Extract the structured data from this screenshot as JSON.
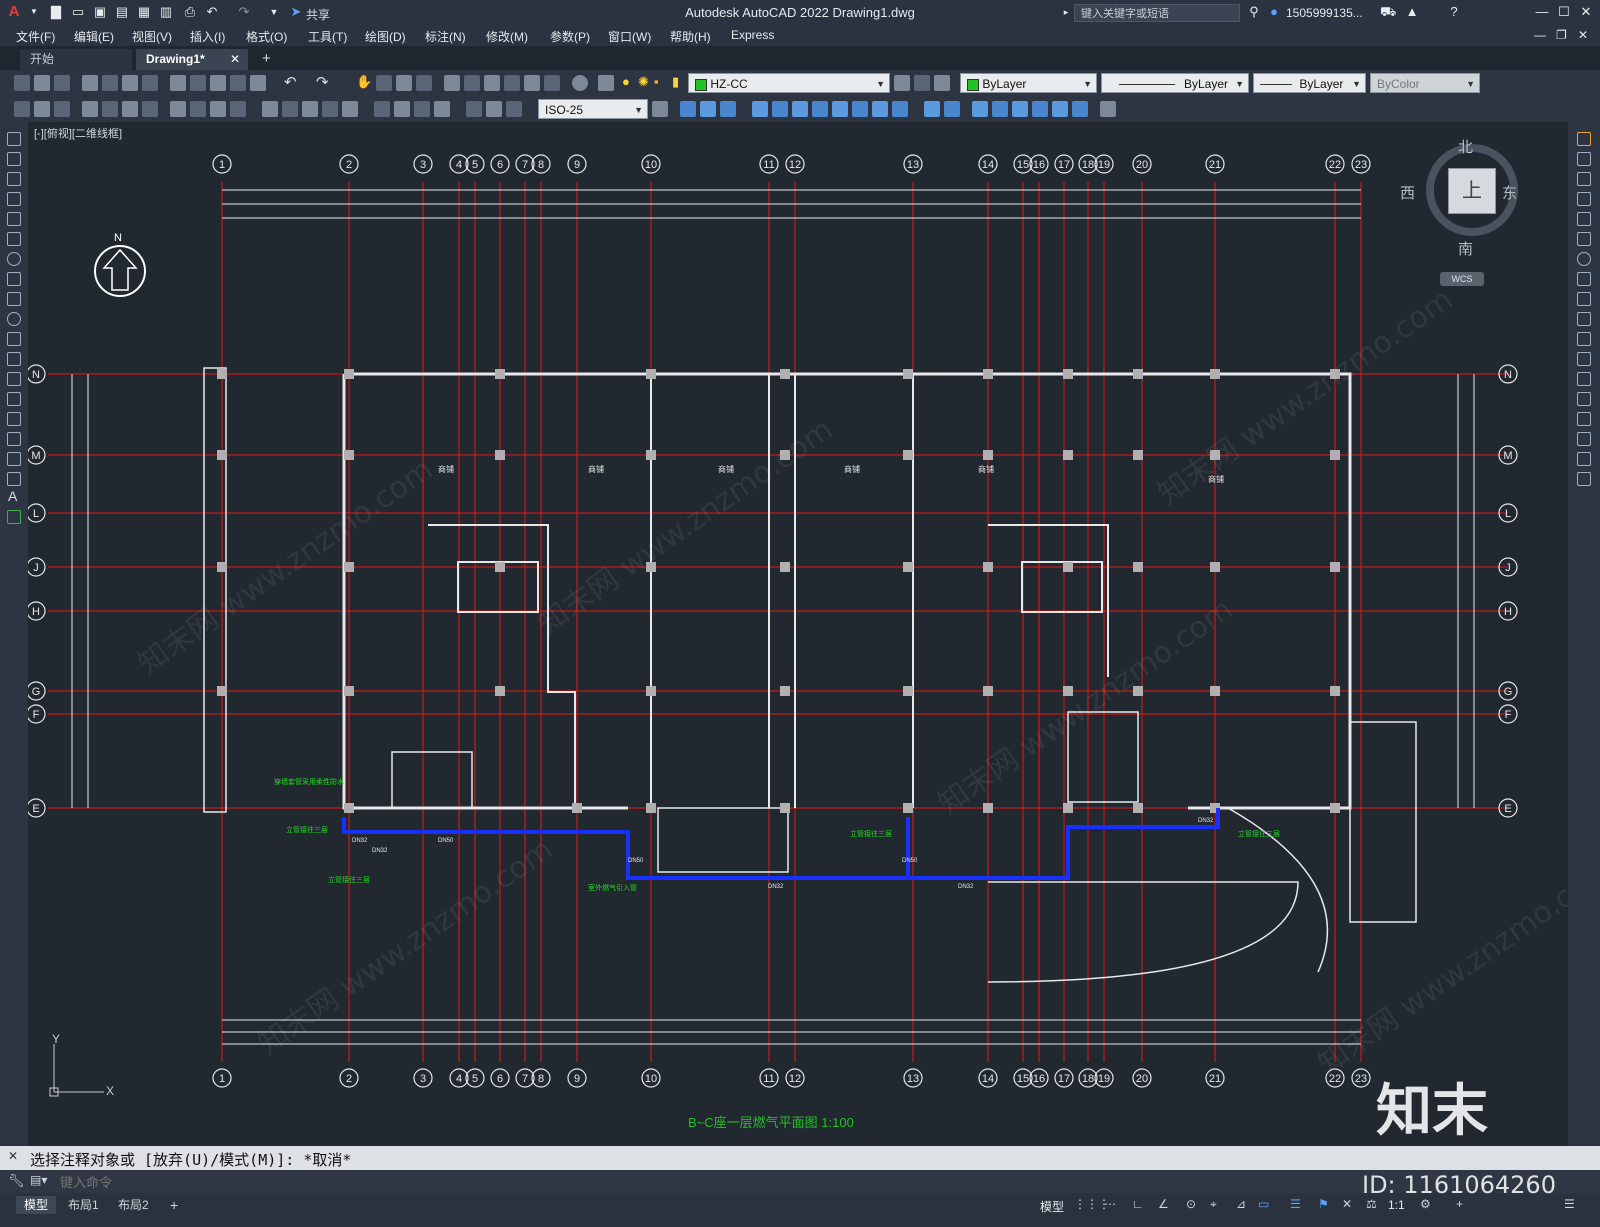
{
  "titlebar": {
    "app_logo": "A",
    "share_label": "共享",
    "title": "Autodesk AutoCAD 2022    Drawing1.dwg",
    "search_placeholder": "键入关键字或短语",
    "user_name": "1505999135...",
    "icons": [
      "autocad-logo-icon",
      "new-icon",
      "open-icon",
      "save-icon",
      "save-as-icon",
      "open-web-icon",
      "plot-icon",
      "undo-icon",
      "redo-icon",
      "share-icon",
      "search-icon",
      "user-icon",
      "cart-icon",
      "autodesk-app-icon",
      "help-icon",
      "minimize-icon",
      "maximize-icon",
      "close-icon"
    ]
  },
  "menubar": {
    "items": [
      "文件(F)",
      "编辑(E)",
      "视图(V)",
      "插入(I)",
      "格式(O)",
      "工具(T)",
      "绘图(D)",
      "标注(N)",
      "修改(M)",
      "参数(P)",
      "窗口(W)",
      "帮助(H)",
      "Express"
    ]
  },
  "filetabs": {
    "tabs": [
      "开始",
      "Drawing1*"
    ],
    "active": "Drawing1*",
    "add_label": "+"
  },
  "toolbar": {
    "layer_name": "HZ-CC",
    "layer_color": "#22c322",
    "color_label": "ByLayer",
    "linetype_label": "ByLayer",
    "lineweight_label": "ByLayer",
    "plotstyle_label": "ByColor",
    "dimstyle_label": "ISO-25"
  },
  "canvas": {
    "viewport_label": "[-][俯视][二维线框]",
    "viewcube": {
      "north": "北",
      "south": "南",
      "west": "西",
      "east": "东",
      "face": "上",
      "wcs": "WCS"
    },
    "north_label": "N",
    "axis_top": [
      "1",
      "2",
      "3",
      "4",
      "5",
      "6",
      "7",
      "8",
      "9",
      "10",
      "11",
      "12",
      "13",
      "14",
      "15",
      "16",
      "17",
      "18",
      "19",
      "20",
      "21",
      "22",
      "23"
    ],
    "axis_side": [
      "N",
      "M",
      "L",
      "J",
      "H",
      "G",
      "F",
      "E"
    ],
    "room_labels": [
      "商铺",
      "商铺",
      "商铺",
      "商铺",
      "商铺",
      "商铺"
    ],
    "pipe_labels": [
      "DN32",
      "DN32",
      "DN50",
      "DN50",
      "DN32",
      "DN32",
      "DN32",
      "DN50"
    ],
    "note_labels": [
      "穿墙套管采用柔性防水",
      "立管接往三层",
      "立管接往三层",
      "室外燃气引入管",
      "立管接往三层",
      "立管接往三层"
    ],
    "bottom_title": "B~C座一层燃气平面图 1:100",
    "ucs_x": "X",
    "ucs_y": "Y",
    "watermark": "知末网 www.znzmo.com",
    "brand": "知末",
    "id_text": "ID: 1161064260"
  },
  "command": {
    "history": "选择注释对象或 [放弃(U)/模式(M)]: *取消*",
    "placeholder": "键入命令"
  },
  "statusbar": {
    "layout_tabs": [
      "模型",
      "布局1",
      "布局2"
    ],
    "add_label": "+",
    "model_label": "模型",
    "scale_label": "1:1"
  }
}
